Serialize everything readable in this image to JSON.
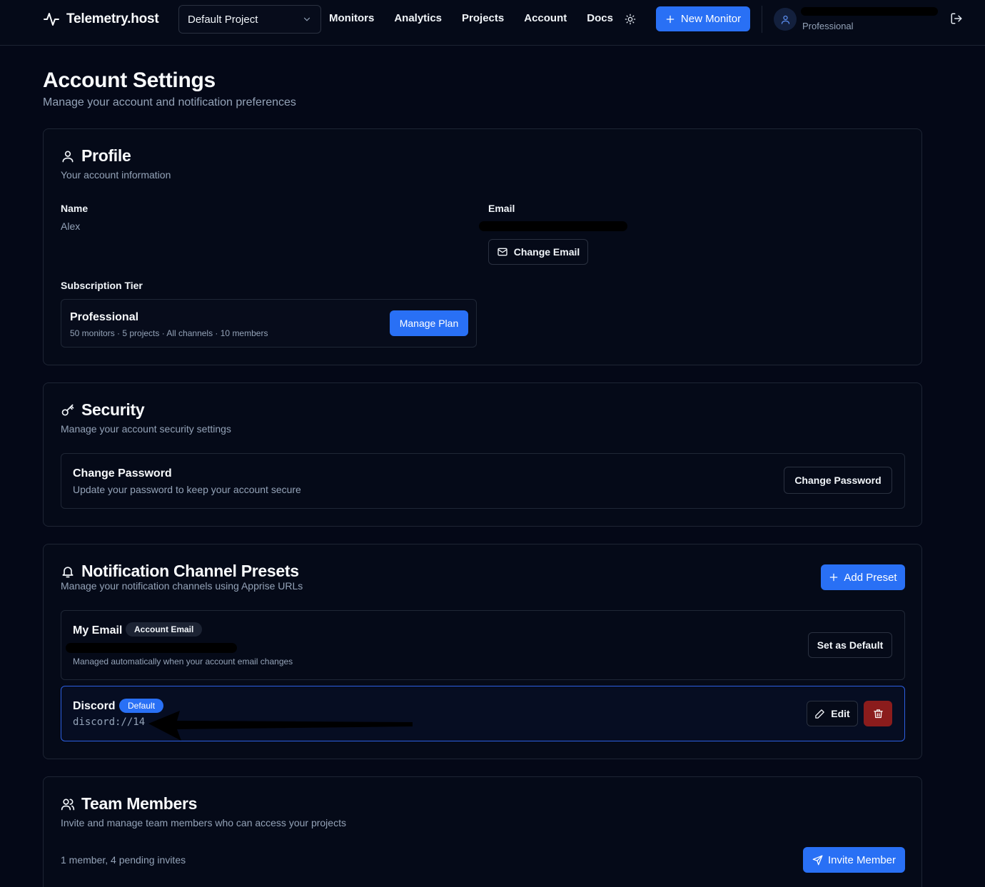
{
  "header": {
    "brand": "Telemetry.host",
    "project_select": "Default Project",
    "nav": [
      "Monitors",
      "Analytics",
      "Projects",
      "Account",
      "Docs"
    ],
    "new_monitor": "New Monitor",
    "user_tier": "Professional"
  },
  "page": {
    "title": "Account Settings",
    "subtitle": "Manage your account and notification preferences"
  },
  "profile": {
    "title": "Profile",
    "subtitle": "Your account information",
    "name_label": "Name",
    "name_value": "Alex",
    "email_label": "Email",
    "change_email": "Change Email",
    "tier_label": "Subscription Tier",
    "tier_name": "Professional",
    "tier_details": "50 monitors · 5 projects · All channels · 10 members",
    "manage_plan": "Manage Plan"
  },
  "security": {
    "title": "Security",
    "subtitle": "Manage your account security settings",
    "box_title": "Change Password",
    "box_sub": "Update your password to keep your account secure",
    "button": "Change Password"
  },
  "notifications": {
    "title": "Notification Channel Presets",
    "subtitle": "Manage your notification channels using Apprise URLs",
    "add_preset": "Add Preset",
    "presets": [
      {
        "name": "My Email",
        "badge": "Account Email",
        "note": "Managed automatically when your account email changes",
        "action": "Set as Default"
      },
      {
        "name": "Discord",
        "badge": "Default",
        "url": "discord://14",
        "edit": "Edit"
      }
    ]
  },
  "team": {
    "title": "Team Members",
    "subtitle": "Invite and manage team members who can access your projects",
    "count": "1 member, 4 pending invites",
    "invite": "Invite Member"
  },
  "colors": {
    "background": "#040817",
    "accent": "#2970f5",
    "danger": "#8b1c1c",
    "muted_text": "#94a3b8"
  }
}
